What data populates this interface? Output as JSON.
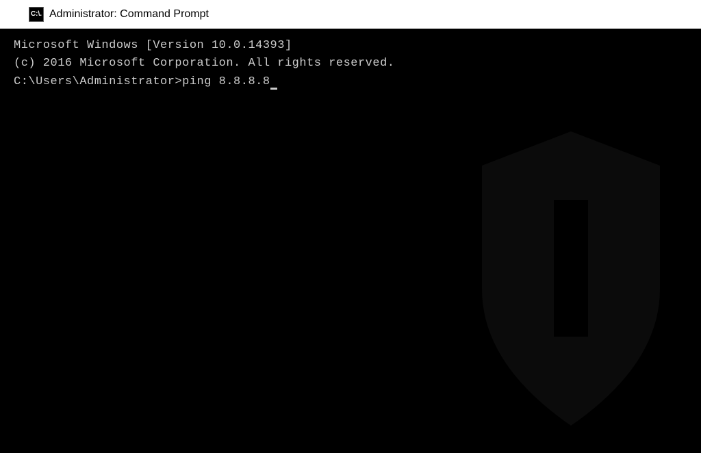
{
  "titleBar": {
    "iconText": "C:\\.",
    "title": "Administrator: Command Prompt"
  },
  "terminal": {
    "line1": "Microsoft Windows [Version 10.0.14393]",
    "line2": "(c) 2016 Microsoft Corporation. All rights reserved.",
    "blankLine": "",
    "prompt": "C:\\Users\\Administrator>",
    "command": "ping 8.8.8.8"
  }
}
